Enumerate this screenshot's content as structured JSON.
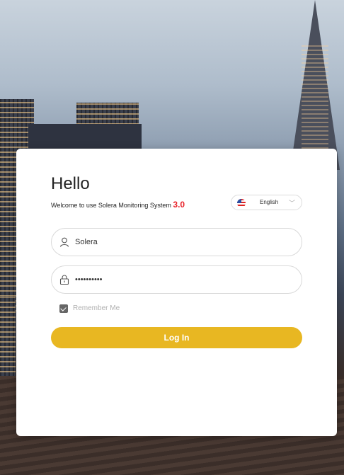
{
  "login": {
    "greeting": "Hello",
    "welcome_text": "Welcome to use Solera Monitoring System",
    "version": "3.0",
    "language": {
      "selected": "English",
      "flag_icon": "us-flag-icon"
    },
    "username": {
      "value": "Solera",
      "icon": "user-icon"
    },
    "password": {
      "value": "••••••••••",
      "icon": "lock-icon"
    },
    "remember_me": {
      "label": "Remember Me",
      "checked": true
    },
    "login_button_label": "Log In"
  },
  "colors": {
    "accent": "#e8b722",
    "version_red": "#e8242b"
  }
}
